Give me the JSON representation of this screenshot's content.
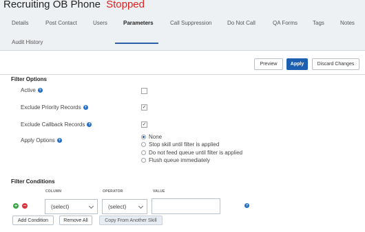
{
  "header": {
    "title": "Recruiting OB Phone",
    "status": "Stopped",
    "status_color": "#e02020"
  },
  "tabs": [
    {
      "label": "Details",
      "active": false
    },
    {
      "label": "Post Contact",
      "active": false
    },
    {
      "label": "Users",
      "active": false
    },
    {
      "label": "Parameters",
      "active": true
    },
    {
      "label": "Call Suppression",
      "active": false
    },
    {
      "label": "Do Not Call",
      "active": false
    },
    {
      "label": "QA Forms",
      "active": false
    },
    {
      "label": "Tags",
      "active": false
    },
    {
      "label": "Notes",
      "active": false
    },
    {
      "label": "Audit History",
      "active": false
    }
  ],
  "toolbar": {
    "preview_label": "Preview",
    "apply_label": "Apply",
    "discard_label": "Discard Changes",
    "accent_color": "#1c5fb0"
  },
  "filter_options": {
    "title": "Filter Options",
    "active": {
      "label": "Active",
      "checked": false
    },
    "exclude_priority": {
      "label": "Exclude Priority Records",
      "checked": true
    },
    "exclude_callback": {
      "label": "Exclude Callback Records",
      "checked": true
    },
    "apply_options": {
      "label": "Apply Options",
      "options": [
        {
          "label": "None",
          "selected": true
        },
        {
          "label": "Stop skill until filter is applied",
          "selected": false
        },
        {
          "label": "Do not feed queue until filter is applied",
          "selected": false
        },
        {
          "label": "Flush queue immediately",
          "selected": false
        }
      ]
    }
  },
  "filter_conditions": {
    "title": "Filter Conditions",
    "columns": {
      "column": "COLUMN",
      "operator": "OPERATOR",
      "value": "VALUE"
    },
    "row": {
      "column_select": "(select)",
      "operator_select": "(select)",
      "value": ""
    },
    "add_condition_label": "Add Condition",
    "remove_all_label": "Remove All",
    "copy_label": "Copy From Another Skill"
  },
  "icons": {
    "help": "help-icon",
    "add": "add-row-icon",
    "remove": "remove-row-icon",
    "chevron": "chevron-down-icon",
    "check": "check-icon"
  }
}
